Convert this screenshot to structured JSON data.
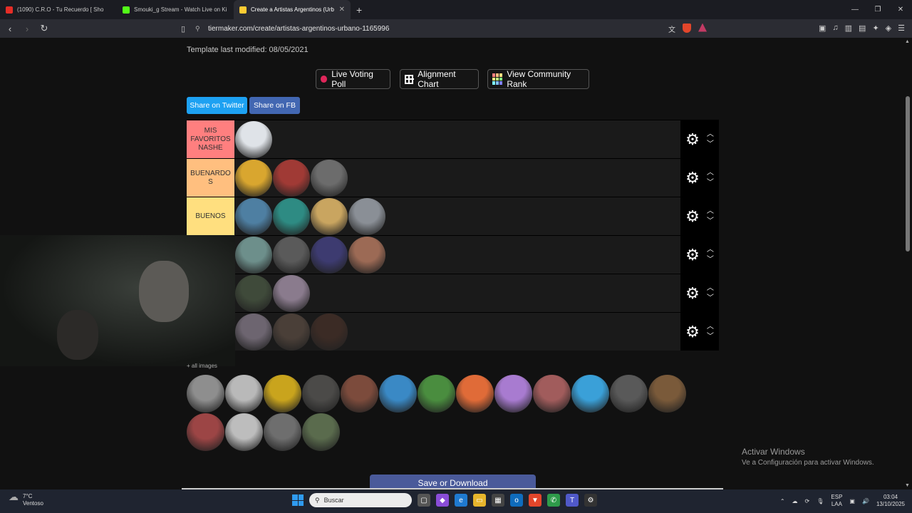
{
  "browser": {
    "tabs": [
      {
        "title": "(1090) C.R.O - Tu Recuerdo [ Sho",
        "color": "#e52d27",
        "active": false
      },
      {
        "title": "Smouki_g Stream - Watch Live on Ki",
        "color": "#53fc18",
        "active": false
      },
      {
        "title": "Create a Artistas Argentinos (Urb",
        "color": "#ffcc33",
        "active": true
      }
    ],
    "url": "tiermaker.com/create/artistas-argentinos-urbano-1165996"
  },
  "page": {
    "modified": "Template last modified: 08/05/2021",
    "buttons": {
      "live_voting": "Live Voting Poll",
      "alignment": "Alignment Chart",
      "community": "View Community Rank"
    },
    "share_twitter": "Share on Twitter",
    "share_fb": "Share on FB",
    "image_count": "+ all images",
    "save": "Save or Download"
  },
  "tiers": [
    {
      "label": "MIS FAVORITOS NASHE",
      "color": "#ff7f7f",
      "items": [
        "#dfe3e8"
      ]
    },
    {
      "label": "BUENARDO S",
      "color": "#ffbf7f",
      "items": [
        "#d9a62f",
        "#a03a35",
        "#6c6c6c"
      ]
    },
    {
      "label": "BUENOS",
      "color": "#ffdf7f",
      "items": [
        "#4e7fa2",
        "#2e8b83",
        "#c9a560",
        "#8a8f96"
      ]
    },
    {
      "label": "",
      "color": "#ffff7f",
      "items": [
        "#6d8f8b",
        "#5a5a5a",
        "#3d3b70",
        "#9c6a55"
      ]
    },
    {
      "label": "",
      "color": "#bfff7f",
      "items": [
        "#3f4a3a",
        "#8a7b8d"
      ]
    },
    {
      "label": "",
      "color": "#7fff7f",
      "items": [
        "#6d6570",
        "#4a3f38",
        "#3b2b25"
      ]
    }
  ],
  "pool": [
    "#8e8e8e",
    "#b9b9b9",
    "#c9a41d",
    "#4b4a48",
    "#7c4b3c",
    "#3a89c5",
    "#4a8d3f",
    "#e06b38",
    "#a87bd0",
    "#a15c5c",
    "#3aa0d8",
    "#595959",
    "#7a5a3a",
    "#9c4545",
    "#bdbdbd",
    "#6e6e6e",
    "#5a6b4d"
  ],
  "watermark": {
    "title": "Activar Windows",
    "subtitle": "Ve a Configuración para activar Windows."
  },
  "taskbar": {
    "temp": "7°C",
    "weather": "Ventoso",
    "search": "Buscar",
    "lang1": "ESP",
    "lang2": "LAA",
    "time": "03:04",
    "date": "13/10/2025"
  }
}
